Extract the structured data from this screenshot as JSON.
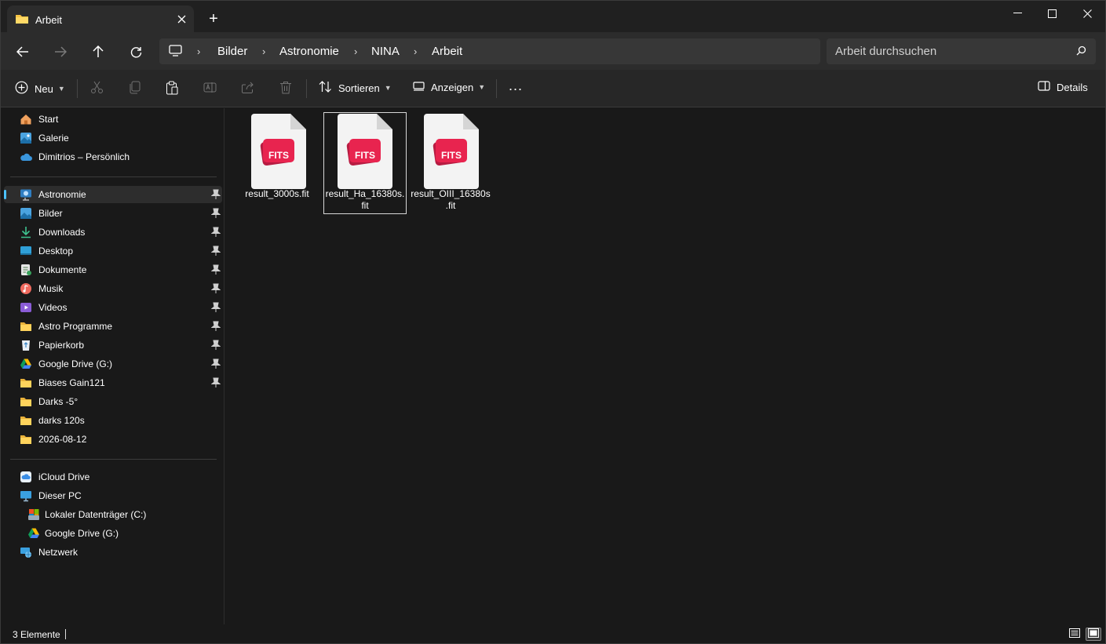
{
  "window": {
    "tab_title": "Arbeit",
    "new_tab_symbol": "+"
  },
  "address": {
    "breadcrumbs": [
      "Bilder",
      "Astronomie",
      "NINA",
      "Arbeit"
    ],
    "search_placeholder": "Arbeit durchsuchen"
  },
  "toolbar": {
    "new_label": "Neu",
    "sort_label": "Sortieren",
    "view_label": "Anzeigen",
    "more_label": "...",
    "details_label": "Details"
  },
  "sidebar": {
    "top_items": [
      {
        "label": "Start",
        "icon": "home-icon"
      },
      {
        "label": "Galerie",
        "icon": "gallery-icon"
      },
      {
        "label": "Dimitrios – Persönlich",
        "icon": "onedrive-icon"
      }
    ],
    "quick_access": [
      {
        "label": "Astronomie",
        "icon": "astronomy-icon",
        "pinned": true,
        "selected": true
      },
      {
        "label": "Bilder",
        "icon": "pictures-icon",
        "pinned": true
      },
      {
        "label": "Downloads",
        "icon": "download-icon",
        "pinned": true
      },
      {
        "label": "Desktop",
        "icon": "desktop-icon",
        "pinned": true
      },
      {
        "label": "Dokumente",
        "icon": "documents-icon",
        "pinned": true
      },
      {
        "label": "Musik",
        "icon": "music-icon",
        "pinned": true
      },
      {
        "label": "Videos",
        "icon": "videos-icon",
        "pinned": true
      },
      {
        "label": "Astro Programme",
        "icon": "folder-icon",
        "pinned": true
      },
      {
        "label": "Papierkorb",
        "icon": "recycle-bin-icon",
        "pinned": true
      },
      {
        "label": "Google Drive (G:)",
        "icon": "google-drive-icon",
        "pinned": true
      },
      {
        "label": "Biases Gain121",
        "icon": "folder-icon",
        "pinned": true
      },
      {
        "label": "Darks -5°",
        "icon": "folder-icon",
        "pinned": false
      },
      {
        "label": "darks 120s",
        "icon": "folder-icon",
        "pinned": false
      },
      {
        "label": "2026-08-12",
        "icon": "folder-icon",
        "pinned": false
      }
    ],
    "devices": [
      {
        "label": "iCloud Drive",
        "icon": "icloud-icon",
        "indent": false
      },
      {
        "label": "Dieser PC",
        "icon": "this-pc-icon",
        "indent": false
      },
      {
        "label": "Lokaler Datenträger (C:)",
        "icon": "local-disk-icon",
        "indent": true
      },
      {
        "label": "Google Drive (G:)",
        "icon": "google-drive-icon",
        "indent": true
      },
      {
        "label": "Netzwerk",
        "icon": "network-icon",
        "indent": false
      }
    ]
  },
  "files": [
    {
      "name": "result_3000s.fit",
      "badge": "FITS",
      "selected": false
    },
    {
      "name": "result_Ha_16380s.fit",
      "badge": "FITS",
      "selected": true
    },
    {
      "name": "result_OIII_16380s.fit",
      "badge": "FITS",
      "selected": false
    }
  ],
  "status": {
    "count_text": "3 Elemente"
  },
  "colors": {
    "accent": "#4cc2ff",
    "fits_badge": "#e8244f",
    "folder": "#f6c344"
  }
}
